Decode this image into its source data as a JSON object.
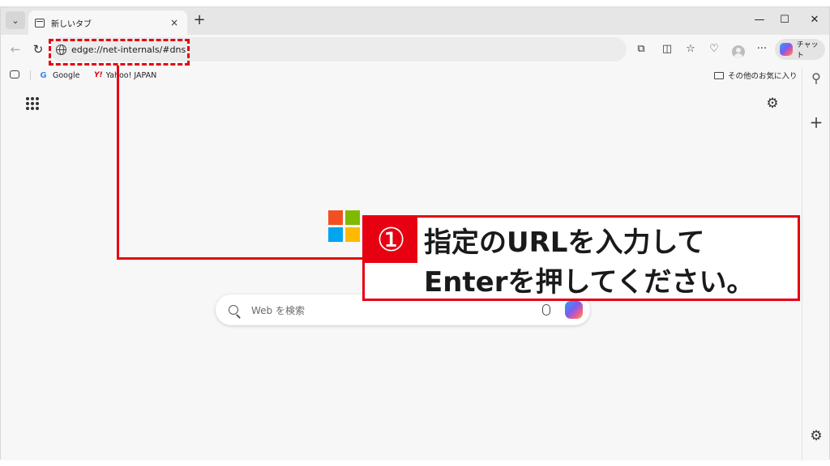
{
  "tabbar": {
    "tab_title": "新しいタブ",
    "tab_close": "×",
    "new_tab": "+",
    "tab_list": "⌄",
    "window_controls": {
      "minimize": "—",
      "maximize": "☐",
      "close": "✕"
    }
  },
  "toolbar": {
    "back": "←",
    "refresh": "↻",
    "url": "edge://net-internals/#dns",
    "icons": [
      "extensions-icon",
      "split-screen-icon",
      "favorites-icon",
      "browser-essentials-icon",
      "profile-icon",
      "more-icon"
    ],
    "extensions_glyph": "⧉",
    "split_glyph": "◫",
    "favorites_glyph": "☆",
    "essentials_glyph": "♡",
    "more_glyph": "···",
    "chat_label": "チャット"
  },
  "bookmarks": {
    "items": [
      {
        "label": "Google"
      },
      {
        "label": "Yahoo! JAPAN"
      }
    ],
    "yahoo_mark": "Y!",
    "google_mark": "G",
    "other_favorites": "その他のお気に入り"
  },
  "sidebar": {
    "search_glyph": "⚲",
    "add_glyph": "+",
    "settings_glyph": "⚙"
  },
  "newtab": {
    "settings_glyph": "⚙",
    "search_placeholder": "Web を検索",
    "logo_colors": [
      "#f25022",
      "#7fba00",
      "#00a4ef",
      "#ffb900"
    ]
  },
  "annotation": {
    "step_number": "①",
    "line1": "指定のURLを入力して",
    "line2": "Enterを押してください。",
    "color": "#e60012"
  }
}
